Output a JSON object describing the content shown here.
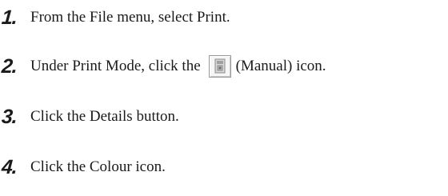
{
  "steps": [
    {
      "number": "1.",
      "text": "From the File menu, select Print."
    },
    {
      "number": "2.",
      "text_before": "Under Print Mode, click the",
      "text_after": "(Manual) icon.",
      "icon": "manual-mode-icon"
    },
    {
      "number": "3.",
      "text": "Click the Details button."
    },
    {
      "number": "4.",
      "text": "Click the Colour icon."
    }
  ]
}
